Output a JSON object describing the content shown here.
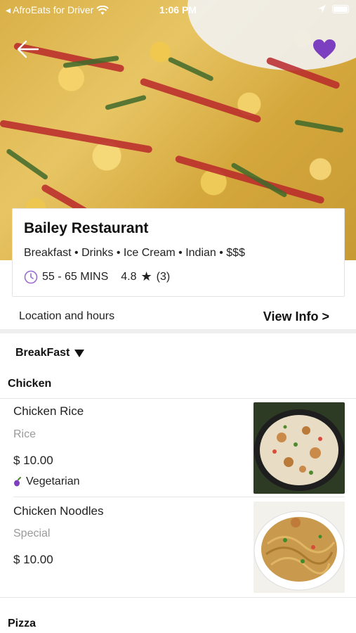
{
  "status_bar": {
    "carrier": "◂ AfroEats for Driver",
    "time": "1:06 PM"
  },
  "restaurant": {
    "name": "Bailey Restaurant",
    "cuisine": "Breakfast • Drinks • Ice Cream • Indian • $$$",
    "delivery_time": "55 - 65 MINS",
    "rating": "4.8",
    "review_count": "(3)"
  },
  "location": {
    "label": "Location and hours",
    "view_info": "View Info >"
  },
  "menu": {
    "selected": "BreakFast",
    "sections": [
      {
        "title": "Chicken",
        "items": [
          {
            "name": "Chicken Rice",
            "category": "Rice",
            "price": "$ 10.00",
            "tag": "Vegetarian"
          },
          {
            "name": "Chicken Noodles",
            "category": "Special",
            "price": "$ 10.00"
          }
        ]
      },
      {
        "title": "Pizza"
      }
    ]
  },
  "colors": {
    "accent": "#7b3fbf",
    "text": "#111111",
    "muted": "#9a9a9a"
  },
  "icons": {
    "back": "back-arrow-icon",
    "favorite": "heart-icon",
    "clock": "clock-icon",
    "star": "star-icon",
    "dropdown": "caret-down-icon",
    "tag": "eggplant-icon"
  }
}
